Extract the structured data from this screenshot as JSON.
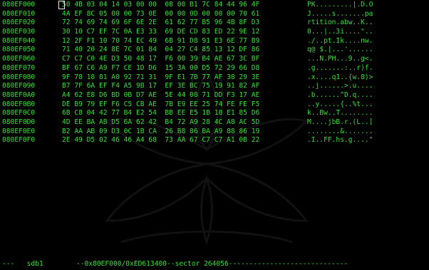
{
  "rows": [
    {
      "addr": "080EF000",
      "hex": "50 4B 03 04 14 03 00 00  08 00 B1 7C 84 44 96 4F",
      "ascii": "PK.........|.D.O"
    },
    {
      "addr": "080EF010",
      "hex": "4A EF 8C 05 00 00 73 0E  00 00 0D 00 00 00 70 61",
      "ascii": "J.....s.......pa"
    },
    {
      "addr": "080EF020",
      "hex": "72 74 69 74 69 6F 6E 2E  61 62 77 B5 96 4B 8F D3",
      "ascii": "rtition.abw..K.."
    },
    {
      "addr": "080EF030",
      "hex": "30 10 C7 EF 7C 0A E3 33  69 DE CD 83 ED 22 9E 12",
      "ascii": "0...|..3i....\".."
    },
    {
      "addr": "080EF040",
      "hex": "12 2F F1 10 70 74 EC 49  6B 91 D8 91 E3 6E 77 B9",
      "ascii": "./..pt.Ik....nw."
    },
    {
      "addr": "080EF050",
      "hex": "71 40 20 24 8E 7C 01 84  04 27 C4 85 13 12 DF 86",
      "ascii": "q@ $.|...'......"
    },
    {
      "addr": "080EF060",
      "hex": "C7 C7 C0 4E D3 50 48 17  F6 00 39 B4 AE 67 3C BF",
      "ascii": "...N.PH...9..g<."
    },
    {
      "addr": "080EF070",
      "hex": "BF 67 C6 A9 F7 CE 1D D6  15 3A 00 D5 72 29 66 D8",
      "ascii": ".g.......:..r)f."
    },
    {
      "addr": "080EF080",
      "hex": "9F 78 18 81 A0 92 71 31  9F E1 7B 77 AF 38 29 3E",
      "ascii": ".x....q1..{w.8)>"
    },
    {
      "addr": "080EF090",
      "hex": "B7 7F 6A EF F4 A5 9B 17  EF 3E BC 75 19 91 82 AF",
      "ascii": "..j......>.u...."
    },
    {
      "addr": "080EF0A0",
      "hex": "A4 62 E8 D6 BD 0B D7 AE  5E 44 08 71 DD F3 17 AE",
      "ascii": ".b......^D.q...."
    },
    {
      "addr": "080EF0B0",
      "hex": "DE B9 79 EF F6 C5 CB AE  7B E9 EE 25 74 FE FE F5",
      "ascii": "..y.....{..%t..."
    },
    {
      "addr": "080EF0C0",
      "hex": "6B C8 04 42 77 B4 E2 54  BB EE E5 1B 18 E1 85 D6",
      "ascii": "k..Bw..T........"
    },
    {
      "addr": "080EF0D0",
      "hex": "4D EE BA AB D5 6A 62 42  B4 72 A9 28 4C A8 AC 5D",
      "ascii": "M....jbB.r.(L..]"
    },
    {
      "addr": "080EF0E0",
      "hex": "B2 AA AB 09 D3 0C 1B CA  26 B8 86 BA A9 88 86 19",
      "ascii": "........&......."
    },
    {
      "addr": "080EF0F0",
      "hex": "2E 49 D5 02 46 46 A4 68  73 AA 67 C7 C7 A1 0B 22",
      "ascii": ".I..FF.hs.g....\""
    }
  ],
  "status": {
    "line": "---   sdb1        --0x80EF000/0xED613400--sector 264056-----------------------------"
  },
  "colors": {
    "background": "#000000",
    "text": "#33e033",
    "cursor": "#e8e8e8"
  }
}
